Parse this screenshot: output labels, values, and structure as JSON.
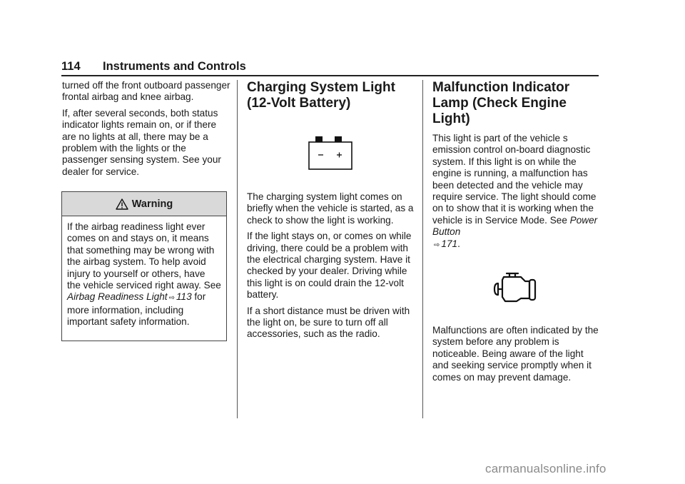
{
  "header": {
    "page_number": "114",
    "section_title": "Instruments and Controls"
  },
  "column1": {
    "paragraphs": [
      "turned off the front outboard passenger frontal airbag and knee airbag.",
      "If, after several seconds, both status indicator lights remain on, or if there are no lights at all, there may be a problem with the lights or the passenger sensing system. See your dealer for service."
    ],
    "warning": {
      "icon": "warning-triangle-icon",
      "title": "Warning",
      "text_before": "If the airbag readiness light ever comes on and stays on, it means that something may be wrong with the airbag system. To help avoid injury to yourself or others, have the vehicle serviced right away. See ",
      "link_text": "Airbag Readiness Light",
      "arrow": "⇨",
      "link_page": "113",
      "text_after": " for more information, including important safety information."
    }
  },
  "column2": {
    "heading": "Charging System Light (12-Volt Battery)",
    "icon": "battery-icon",
    "icon_symbols": {
      "minus": "−",
      "plus": "+"
    },
    "paragraphs": [
      "The charging system light comes on briefly when the vehicle is started, as a check to show the light is working.",
      "If the light stays on, or comes on while driving, there could be a problem with the electrical charging system. Have it checked by your dealer. Driving while this light is on could drain the 12-volt battery.",
      "If a short distance must be driven with the light on, be sure to turn off all accessories, such as the radio."
    ]
  },
  "column3": {
    "heading": "Malfunction Indicator Lamp (Check Engine Light)",
    "paragraph1_before": "This light is part of the vehicle s emission control on-board diagnostic system. If this light is on while the engine is running, a malfunction has been detected and the vehicle may require service. The light should come on to show that it is working when the vehicle is in Service Mode. See ",
    "paragraph1_link": "Power Button",
    "paragraph1_arrow": "⇨",
    "paragraph1_page": "171",
    "paragraph1_after": ".",
    "icon": "check-engine-icon",
    "paragraph2": "Malfunctions are often indicated by the system before any problem is noticeable. Being aware of the light and seeking service promptly when it comes on may prevent damage."
  },
  "watermark": "carmanualsonline.info"
}
